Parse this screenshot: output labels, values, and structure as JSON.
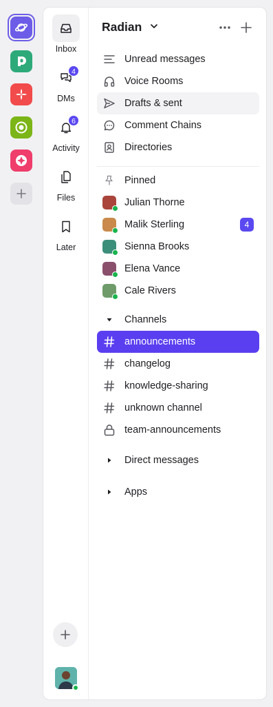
{
  "colors": {
    "accent": "#5a3ff0",
    "online": "#18b44c",
    "badge": "#5a48f0"
  },
  "workspaces": [
    {
      "name": "saturn-workspace-icon",
      "color": "#6c5ce7",
      "active": true
    },
    {
      "name": "d-workspace-icon",
      "color": "#2eaa7a"
    },
    {
      "name": "flower-workspace-icon",
      "color": "#f24b4b"
    },
    {
      "name": "target-workspace-icon",
      "color": "#7cb518"
    },
    {
      "name": "diamond-workspace-icon",
      "color": "#ef3d6c"
    }
  ],
  "nav": {
    "inbox": "Inbox",
    "dms": "DMs",
    "dms_badge": "4",
    "activity": "Activity",
    "activity_badge": "6",
    "files": "Files",
    "later": "Later"
  },
  "sidebar": {
    "workspace_name": "Radian",
    "menu": [
      {
        "label": "Unread messages",
        "icon": "lines-icon"
      },
      {
        "label": "Voice Rooms",
        "icon": "headphones-icon"
      },
      {
        "label": "Drafts & sent",
        "icon": "send-icon"
      },
      {
        "label": "Comment Chains",
        "icon": "comment-icon"
      },
      {
        "label": "Directories",
        "icon": "contact-card-icon"
      }
    ],
    "pinned_label": "Pinned",
    "people": [
      {
        "name": "Julian Thorne",
        "color": "#a9453b"
      },
      {
        "name": "Malik Sterling",
        "color": "#c98a4b",
        "badge": "4"
      },
      {
        "name": "Sienna Brooks",
        "color": "#3b8f7a"
      },
      {
        "name": "Elena Vance",
        "color": "#8a4f6b"
      },
      {
        "name": "Cale Rivers",
        "color": "#6f9b6a"
      }
    ],
    "channels_label": "Channels",
    "channels": [
      {
        "name": "announcements",
        "icon": "hash-icon",
        "selected": true
      },
      {
        "name": "changelog",
        "icon": "hash-icon"
      },
      {
        "name": "knowledge-sharing",
        "icon": "hash-icon"
      },
      {
        "name": "unknown channel",
        "icon": "hash-icon"
      },
      {
        "name": "team-announcements",
        "icon": "lock-icon"
      }
    ],
    "direct_messages_label": "Direct messages",
    "apps_label": "Apps"
  }
}
